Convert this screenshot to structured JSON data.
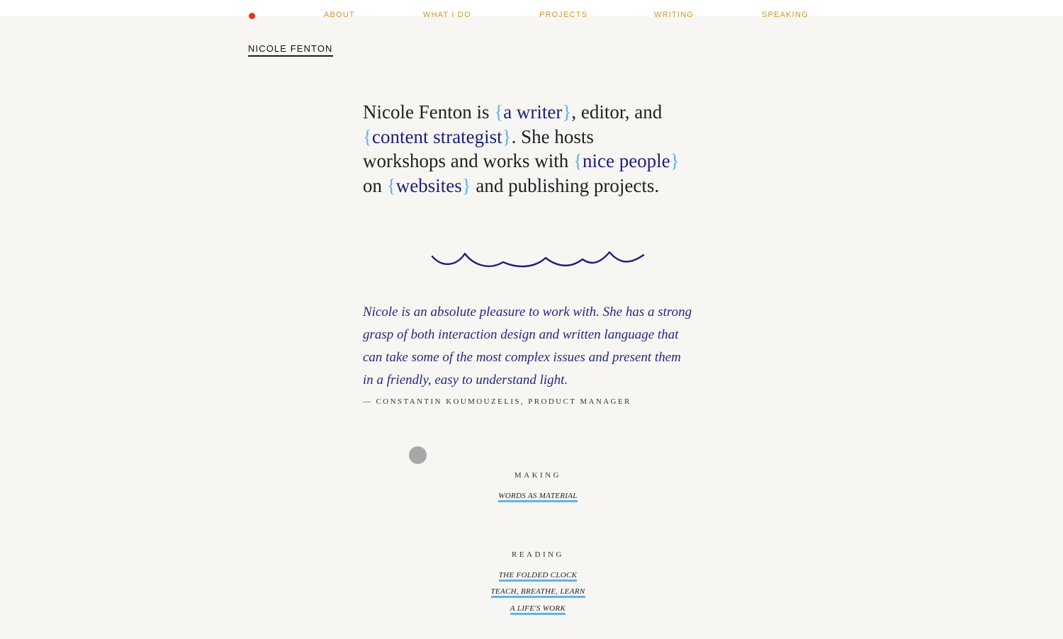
{
  "nav": {
    "items": [
      {
        "label": "ABOUT"
      },
      {
        "label": "WHAT I DO"
      },
      {
        "label": "PROJECTS"
      },
      {
        "label": "WRITING"
      },
      {
        "label": "SPEAKING"
      }
    ]
  },
  "site": {
    "name": "NICOLE FENTON"
  },
  "intro": {
    "t1": "Nicole Fenton is ",
    "link1": "a writer",
    "t2": ", editor, and",
    "link2": "content strategist",
    "t3": ". She hosts",
    "t4": "workshops and works with ",
    "link3": "nice people",
    "t5": "on ",
    "link4": "websites",
    "t6": " and publishing projects.",
    "brace_open": "{",
    "brace_close": "}"
  },
  "testimonial": {
    "quote_lines": [
      "Nicole is an absolute pleasure to work with. She has a strong",
      "grasp of both interaction design and written language that",
      "can take some of the most complex issues and present them",
      "in a friendly, easy to understand light."
    ],
    "attribution": "— CONSTANTIN KOUMOUZELIS, PRODUCT MANAGER"
  },
  "making": {
    "heading": "MAKING",
    "links": [
      "WORDS AS MATERIAL"
    ]
  },
  "reading": {
    "heading": "READING",
    "links": [
      "THE FOLDED CLOCK",
      "TEACH, BREATHE, LEARN",
      "A LIFE'S WORK"
    ]
  },
  "colors": {
    "background": "#f7f6f3",
    "nav_gold": "#c9962d",
    "accent_red": "#e8341c",
    "link_navy": "#1d1e78",
    "brace_blue": "#5fb4ea",
    "quote_indigo": "#26267f"
  }
}
